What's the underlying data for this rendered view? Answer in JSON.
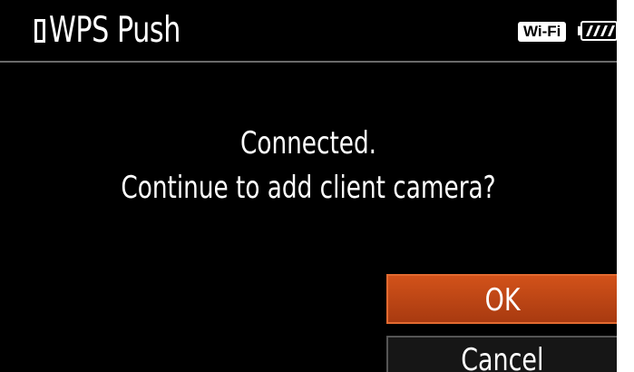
{
  "header": {
    "title": "WPS Push",
    "wifi_badge": "Wi-Fi",
    "battery_icon": "battery-icon",
    "title_icon": "phone-icon"
  },
  "dialog": {
    "line1": "Connected.",
    "line2": "Continue to add client camera?"
  },
  "buttons": {
    "ok_label": "OK",
    "cancel_label": "Cancel"
  },
  "colors": {
    "background": "#000000",
    "text": "#ffffff",
    "ok_button": "#c0461a",
    "cancel_button": "#161616"
  }
}
